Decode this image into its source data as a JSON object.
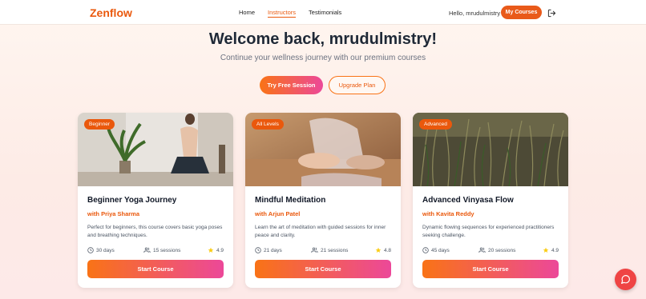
{
  "nav": {
    "logo": "Zenflow",
    "links": [
      "Home",
      "Instructors",
      "Testimonials"
    ],
    "greeting": "Hello, mrudulmistry",
    "my_courses": "My Courses"
  },
  "hero": {
    "title": "Welcome back, mrudulmistry!",
    "subtitle": "Continue your wellness journey with our premium courses",
    "free_session": "Try Free Session",
    "upgrade": "Upgrade Plan"
  },
  "courses": [
    {
      "badge": "Beginner",
      "title": "Beginner Yoga Journey",
      "instructor": "with Priya Sharma",
      "description": "Perfect for beginners, this course covers basic yoga poses and breathing techniques.",
      "duration": "30 days",
      "sessions": "15 sessions",
      "rating": "4.9",
      "cta": "Start Course"
    },
    {
      "badge": "All Levels",
      "title": "Mindful Meditation",
      "instructor": "with Arjun Patel",
      "description": "Learn the art of meditation with guided sessions for inner peace and clarity.",
      "duration": "21 days",
      "sessions": "21 sessions",
      "rating": "4.8",
      "cta": "Start Course"
    },
    {
      "badge": "Advanced",
      "title": "Advanced Vinyasa Flow",
      "instructor": "with Kavita Reddy",
      "description": "Dynamic flowing sequences for experienced practitioners seeking challenge.",
      "duration": "45 days",
      "sessions": "20 sessions",
      "rating": "4.9",
      "cta": "Start Course"
    }
  ],
  "colors": {
    "accent": "#ea580c",
    "gradient_start": "#f97316",
    "gradient_end": "#ec4899",
    "chat": "#ef4444"
  },
  "icons": [
    "logout-icon",
    "clock-icon",
    "users-icon",
    "star-icon",
    "chat-icon"
  ]
}
